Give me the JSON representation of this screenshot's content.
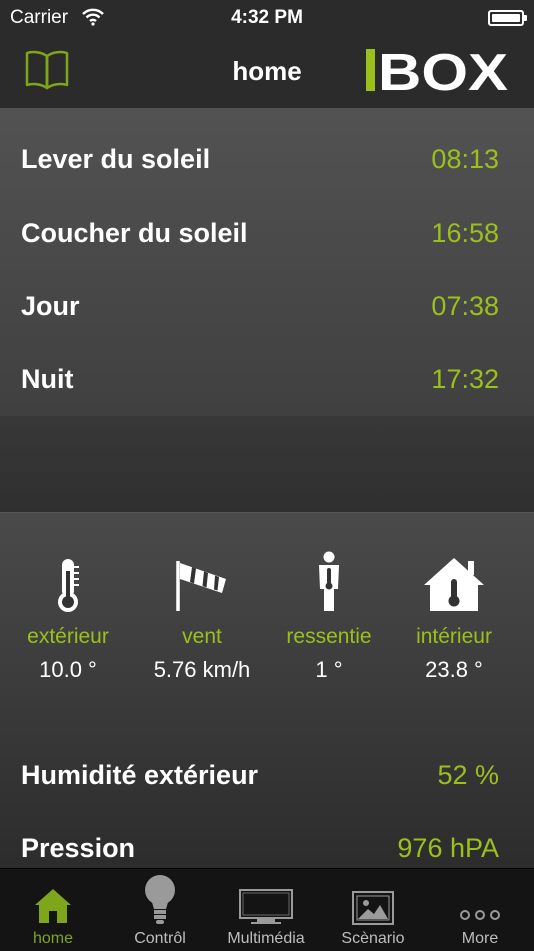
{
  "status_bar": {
    "carrier": "Carrier",
    "time": "4:32 PM"
  },
  "nav": {
    "title": "home",
    "logo_text": "BOX",
    "left_icon": "book-icon"
  },
  "sun": [
    {
      "label": "Lever du soleil",
      "value": "08:13"
    },
    {
      "label": "Coucher du soleil",
      "value": "16:58"
    },
    {
      "label": "Jour",
      "value": "07:38"
    },
    {
      "label": "Nuit",
      "value": "17:32"
    }
  ],
  "weather": [
    {
      "icon": "thermometer-icon",
      "label": "extérieur",
      "value": "10.0 °"
    },
    {
      "icon": "windsock-icon",
      "label": "vent",
      "value": "5.76 km/h"
    },
    {
      "icon": "person-thermometer-icon",
      "label": "ressentie",
      "value": "1 °"
    },
    {
      "icon": "house-thermometer-icon",
      "label": "intérieur",
      "value": "23.8 °"
    }
  ],
  "info": [
    {
      "label": "Humidité extérieur",
      "value": "52 %"
    },
    {
      "label": "Pression",
      "value": "976 hPA"
    }
  ],
  "tabs": [
    {
      "icon": "house-icon",
      "label": "home",
      "active": true
    },
    {
      "icon": "bulb-icon",
      "label": "Contrôl",
      "active": false
    },
    {
      "icon": "monitor-icon",
      "label": "Multimédia",
      "active": false
    },
    {
      "icon": "picture-icon",
      "label": "Scènario",
      "active": false
    },
    {
      "icon": "more-icon",
      "label": "More",
      "active": false
    }
  ],
  "colors": {
    "accent": "#9bc01c",
    "tab_active": "#7fa51a",
    "background": "#2a2a2a"
  }
}
